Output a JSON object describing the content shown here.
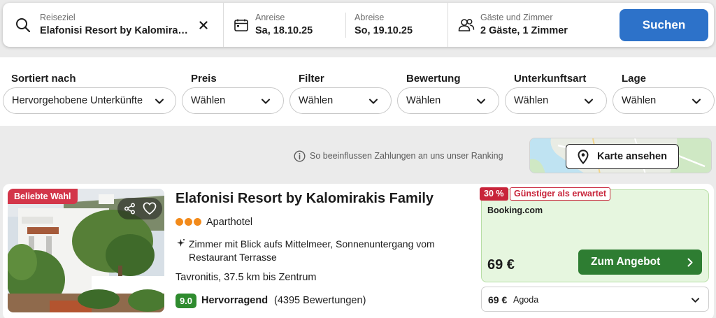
{
  "search": {
    "destination_label": "Reiseziel",
    "destination_value": "Elafonisi Resort by Kalomira…",
    "checkin_label": "Anreise",
    "checkin_value": "Sa, 18.10.25",
    "checkout_label": "Abreise",
    "checkout_value": "So, 19.10.25",
    "guests_label": "Gäste und Zimmer",
    "guests_value": "2 Gäste, 1 Zimmer",
    "search_button": "Suchen",
    "accent_color": "#2d72c9"
  },
  "filters": [
    {
      "label": "Sortiert nach",
      "value": "Hervorgehobene Unterkünfte"
    },
    {
      "label": "Preis",
      "value": "Wählen"
    },
    {
      "label": "Filter",
      "value": "Wählen"
    },
    {
      "label": "Bewertung",
      "value": "Wählen"
    },
    {
      "label": "Unterkunftsart",
      "value": "Wählen"
    },
    {
      "label": "Lage",
      "value": "Wählen"
    }
  ],
  "info": {
    "ranking_text": "So beeinflussen Zahlungen an uns unser Ranking",
    "map_button": "Karte ansehen"
  },
  "result": {
    "badge": "Beliebte Wahl",
    "title": "Elafonisi Resort by Kalomirakis Family",
    "type_stars": 3,
    "type": "Aparthotel",
    "feature_icon": "sparkle-icon",
    "feature": "Zimmer mit Blick aufs Mittelmeer, Sonnenuntergang vom Restaurant Terrasse",
    "location": "Tavronitis, 37.5 km bis Zentrum",
    "rating": "9.0",
    "rating_word": "Hervorragend",
    "rating_count": "(4395 Bewertungen)",
    "deal": {
      "discount_pct": "30 %",
      "discount_text": "Günstiger als erwartet",
      "provider": "Booking.com",
      "price": "69 €",
      "button": "Zum Angebot",
      "button_color": "#2e7d32"
    },
    "alt_offer": {
      "price": "69 €",
      "provider": "Agoda"
    }
  }
}
